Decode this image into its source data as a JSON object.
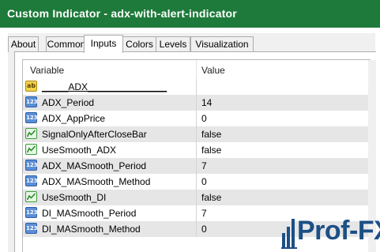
{
  "window": {
    "title": "Custom Indicator - adx-with-alert-indicator",
    "accent": "#1e7a3a"
  },
  "tabs": [
    {
      "label": "About",
      "active": false
    },
    {
      "label": "Common",
      "active": false
    },
    {
      "label": "Inputs",
      "active": true
    },
    {
      "label": "Colors",
      "active": false
    },
    {
      "label": "Levels",
      "active": false
    },
    {
      "label": "Visualization",
      "active": false
    }
  ],
  "grid": {
    "col_variable": "Variable",
    "col_value": "Value",
    "rows": [
      {
        "icon": "string-icon",
        "icon_text": "ab",
        "variable": "_____ADX_______________",
        "value": ""
      },
      {
        "icon": "number-icon",
        "icon_text": "123",
        "variable": "ADX_Period",
        "value": "14"
      },
      {
        "icon": "number-icon",
        "icon_text": "123",
        "variable": "ADX_AppPrice",
        "value": "0"
      },
      {
        "icon": "bool-icon",
        "icon_text": "",
        "variable": "SignalOnlyAfterCloseBar",
        "value": "false"
      },
      {
        "icon": "bool-icon",
        "icon_text": "",
        "variable": "UseSmooth_ADX",
        "value": "false"
      },
      {
        "icon": "number-icon",
        "icon_text": "123",
        "variable": "ADX_MASmooth_Period",
        "value": "7"
      },
      {
        "icon": "number-icon",
        "icon_text": "123",
        "variable": "ADX_MASmooth_Method",
        "value": "0"
      },
      {
        "icon": "bool-icon",
        "icon_text": "",
        "variable": "UseSmooth_DI",
        "value": "false"
      },
      {
        "icon": "number-icon",
        "icon_text": "123",
        "variable": "DI_MASmooth_Period",
        "value": "7"
      },
      {
        "icon": "number-icon",
        "icon_text": "123",
        "variable": "DI_MASmooth_Method",
        "value": "0"
      }
    ]
  },
  "watermark": {
    "text": "Prof-FX",
    "color": "#1c4f86"
  }
}
